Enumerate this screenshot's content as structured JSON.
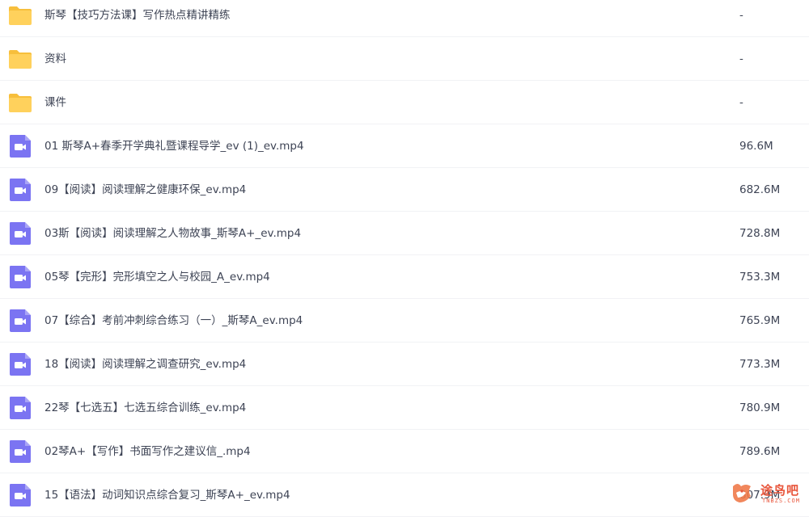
{
  "files": [
    {
      "type": "folder",
      "icon": "folder-icon",
      "name": "斯琴【技巧方法课】写作热点精讲精练",
      "size": "-"
    },
    {
      "type": "folder",
      "icon": "folder-icon",
      "name": "资料",
      "size": "-"
    },
    {
      "type": "folder",
      "icon": "folder-icon",
      "name": "课件",
      "size": "-"
    },
    {
      "type": "video",
      "icon": "video-file-icon",
      "name": "01 斯琴A+春季开学典礼暨课程导学_ev (1)_ev.mp4",
      "size": "96.6M"
    },
    {
      "type": "video",
      "icon": "video-file-icon",
      "name": "09【阅读】阅读理解之健康环保_ev.mp4",
      "size": "682.6M"
    },
    {
      "type": "video",
      "icon": "video-file-icon",
      "name": "03斯【阅读】阅读理解之人物故事_斯琴A+_ev.mp4",
      "size": "728.8M"
    },
    {
      "type": "video",
      "icon": "video-file-icon",
      "name": "05琴【完形】完形填空之人与校园_A_ev.mp4",
      "size": "753.3M"
    },
    {
      "type": "video",
      "icon": "video-file-icon",
      "name": "07【综合】考前冲刺综合练习（一）_斯琴A_ev.mp4",
      "size": "765.9M"
    },
    {
      "type": "video",
      "icon": "video-file-icon",
      "name": "18【阅读】阅读理解之调查研究_ev.mp4",
      "size": "773.3M"
    },
    {
      "type": "video",
      "icon": "video-file-icon",
      "name": "22琴【七选五】七选五综合训练_ev.mp4",
      "size": "780.9M"
    },
    {
      "type": "video",
      "icon": "video-file-icon",
      "name": "02琴A+【写作】书面写作之建议信_.mp4",
      "size": "789.6M"
    },
    {
      "type": "video",
      "icon": "video-file-icon",
      "name": "15【语法】动词知识点综合复习_斯琴A+_ev.mp4",
      "size": "807.9M"
    }
  ],
  "watermark": {
    "text": "途鸟吧",
    "sub": "TNBZS.COM",
    "logo": "fox-logo-icon"
  },
  "colors": {
    "folder": "#ffd15c",
    "folder_dark": "#f7bf3c",
    "video": "#7b74f2",
    "divider": "#f1f2f5"
  }
}
